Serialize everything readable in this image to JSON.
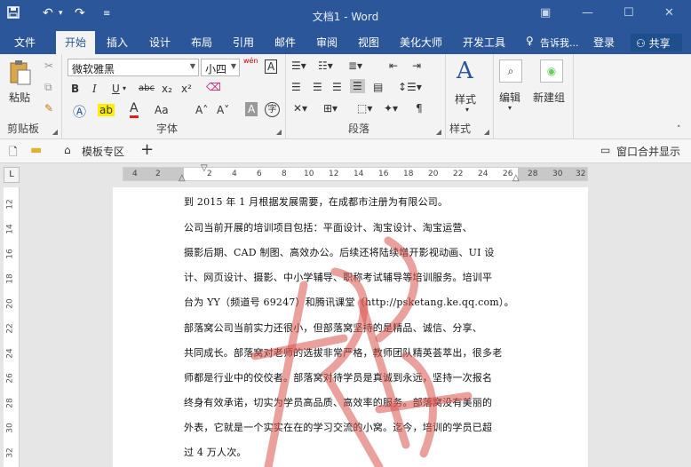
{
  "window": {
    "title": "文档1 - Word"
  },
  "tabs": [
    "文件",
    "开始",
    "插入",
    "设计",
    "布局",
    "引用",
    "邮件",
    "审阅",
    "视图",
    "美化大师",
    "开发工具"
  ],
  "active_tab": "开始",
  "tell_me": "告诉我...",
  "login": "登录",
  "share": "共享",
  "ribbon": {
    "clipboard": {
      "paste": "粘贴",
      "label": "剪贴板"
    },
    "font": {
      "name": "微软雅黑",
      "size": "小四",
      "label": "字体",
      "wen_icon": "wén",
      "bold": "B",
      "italic": "I",
      "underline": "U",
      "strike": "abc",
      "sub": "x₂",
      "sup": "x²",
      "font_color": "A",
      "case": "Aa",
      "grow": "A˄",
      "shrink": "A˅",
      "shade_a": "A",
      "circle_char": "字"
    },
    "paragraph": {
      "label": "段落"
    },
    "styles": {
      "button": "样式",
      "label": "样式"
    },
    "editing": {
      "button": "编辑"
    },
    "newgroup": {
      "button": "新建组"
    }
  },
  "doc_toolbar": {
    "template": "模板专区",
    "add": "+",
    "merge": "窗口合并显示"
  },
  "ruler": {
    "h": [
      "4",
      "2",
      "2",
      "4",
      "6",
      "8",
      "10",
      "12",
      "14",
      "16",
      "18",
      "20",
      "22",
      "24",
      "26",
      "28",
      "30",
      "32"
    ],
    "v": [
      "12",
      "14",
      "16",
      "18",
      "20",
      "22",
      "24",
      "26",
      "28",
      "30",
      "32"
    ],
    "corner": "L"
  },
  "document": {
    "lines": [
      "到 2015 年 1 月根据发展需要，在成都市注册为有限公司。",
      "    公司当前开展的培训项目包括：平面设计、淘宝设计、淘宝运营、",
      "摄影后期、CAD 制图、高效办公。后续还将陆续增开影视动画、UI 设",
      "计、网页设计、摄影、中小学辅导、职称考试辅导等培训服务。培训平",
      "台为 YY（频道号 69247）和腾讯课堂（http://psketang.ke.qq.com）。",
      "    部落窝公司当前实力还很小，但部落窝坚持的是精品、诚信、分享、",
      "共同成长。部落窝对老师的选拔非常严格，教师团队精英荟萃出，很多老",
      "师都是行业中的佼佼者。部落窝对待学员是真诚到永远，坚持一次报名",
      "终身有效承诺，切实为学员高品质、高效率的服务。部落窝没有美丽的",
      "外表，它就是一个实实在在的学习交流的小窝。迄今，培训的学员已超",
      "过 4 万人次。"
    ]
  },
  "colors": {
    "accent": "#2b579a",
    "watermark": "#d9534f"
  }
}
